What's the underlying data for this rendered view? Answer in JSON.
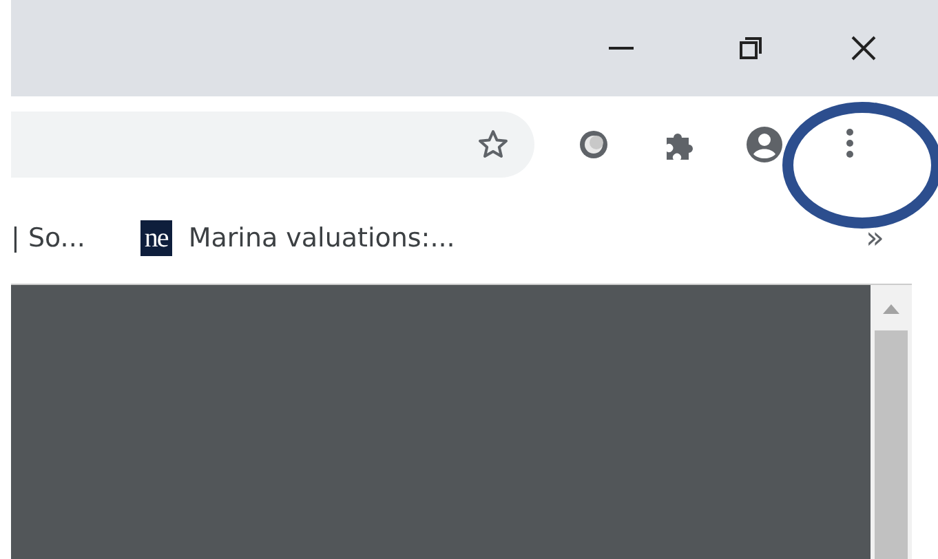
{
  "window": {
    "controls": [
      {
        "kind": "minimize"
      },
      {
        "kind": "restore"
      },
      {
        "kind": "close"
      }
    ]
  },
  "toolbar": {
    "buttons": [
      {
        "kind": "extension"
      },
      {
        "kind": "puzzle"
      },
      {
        "kind": "profile"
      },
      {
        "kind": "menu"
      }
    ]
  },
  "bookmarks": {
    "items": [
      {
        "label": "| So..."
      },
      {
        "favicon": "ne",
        "label": "Marina valuations:..."
      }
    ],
    "overflow": "»"
  },
  "annotations": [
    {
      "kind": "ellipse",
      "color": "#2c4e8e"
    }
  ]
}
